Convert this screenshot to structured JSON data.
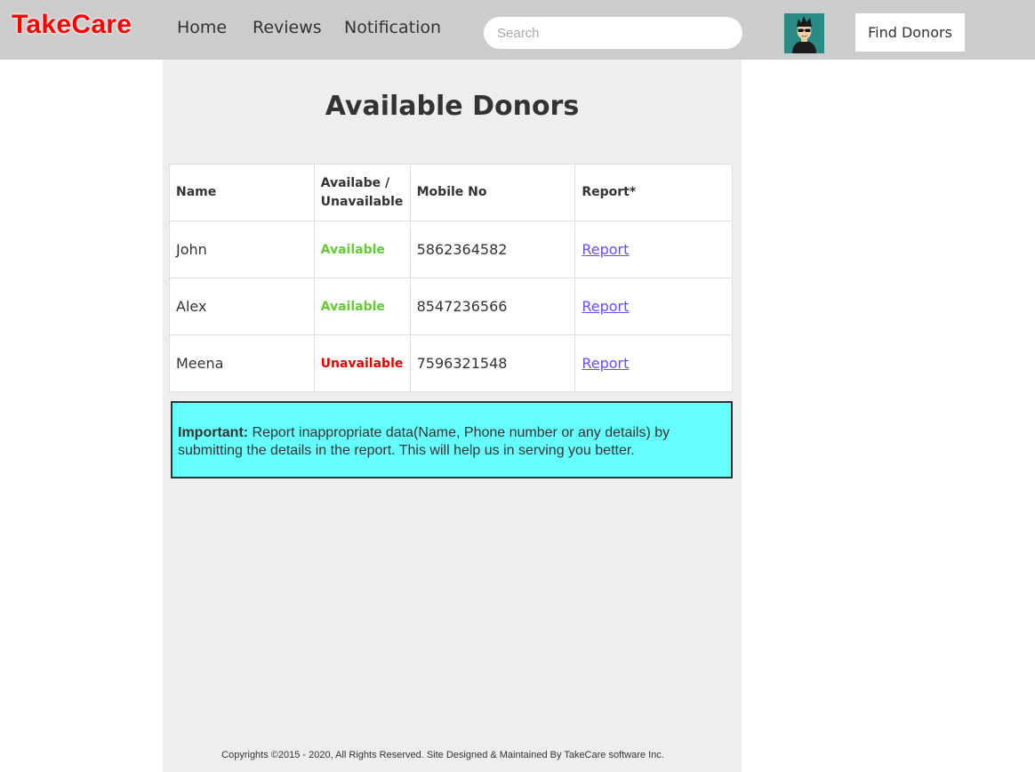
{
  "brand": "TakeCare",
  "nav": {
    "home": "Home",
    "reviews": "Reviews",
    "notification": "Notification",
    "search_placeholder": "Search",
    "find_donors": "Find Donors"
  },
  "page_title": "Available Donors",
  "table": {
    "headers": {
      "name": "Name",
      "availability_line1": "Availabe /",
      "availability_line2": "Unavailable",
      "mobile": "Mobile No",
      "report": "Report*"
    },
    "rows": [
      {
        "name": "John",
        "status": "Available",
        "status_color": "#66cc33",
        "mobile": "5862364582",
        "report": "Report"
      },
      {
        "name": "Alex",
        "status": "Available",
        "status_color": "#66cc33",
        "mobile": "8547236566",
        "report": "Report"
      },
      {
        "name": "Meena",
        "status": "Unavailable",
        "status_color": "#e60000",
        "mobile": "7596321548",
        "report": "Report"
      }
    ]
  },
  "notice": {
    "label": "Important:",
    "text": " Report inappropriate data(Name, Phone number or any details) by submitting the details in the report. This will help us in serving you better."
  },
  "footer": "Copyrights ©2015 - 2020, All Rights Reserved. Site Designed & Maintained By TakeCare software Inc.",
  "colors": {
    "brand": "#ff0000",
    "navbar": "#cccccc",
    "content_bg": "#eeeeee",
    "notice_bg": "#66ffff",
    "link": "#6a4df5"
  }
}
